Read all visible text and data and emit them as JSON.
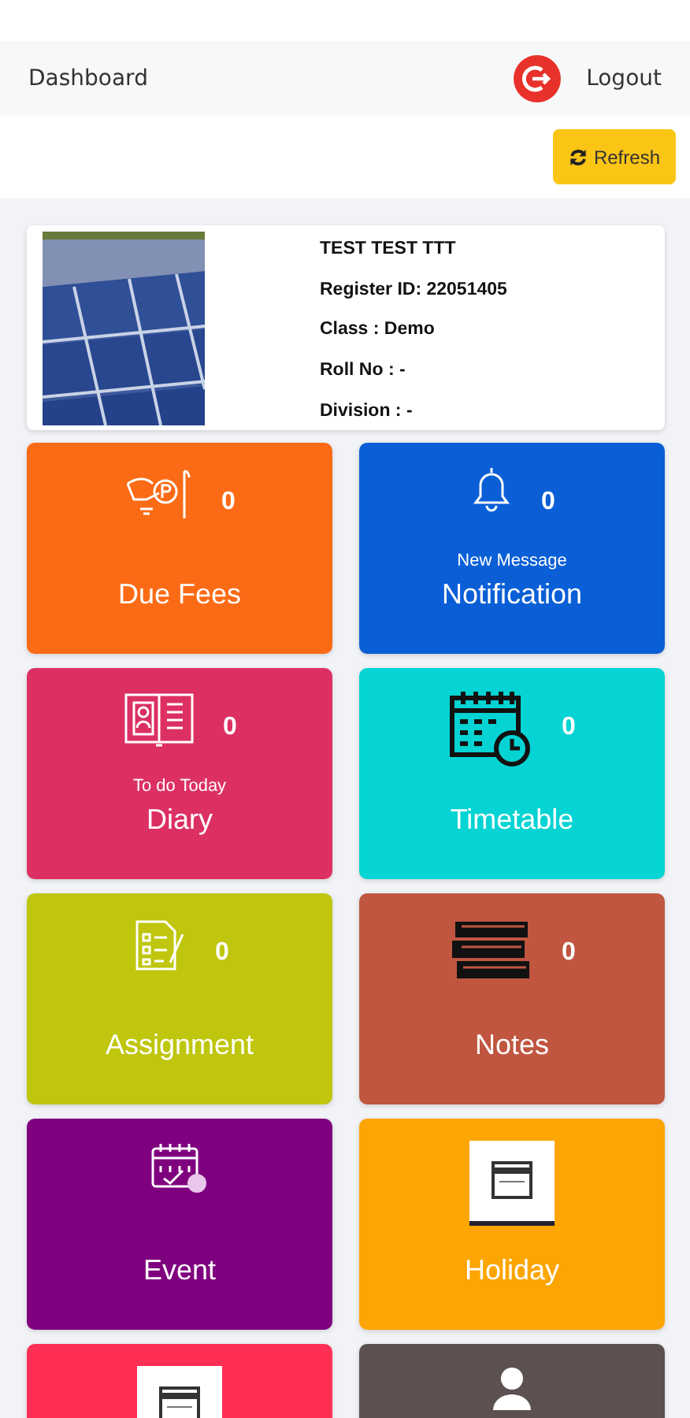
{
  "header": {
    "title": "Dashboard",
    "logout": "Logout"
  },
  "refresh": "Refresh",
  "profile": {
    "name": "TEST TEST TTT",
    "lines": [
      "Register ID: 22051405",
      "Class : Demo",
      "Roll No : -",
      "Division : -"
    ]
  },
  "tiles": [
    {
      "kind": "fees",
      "color": "#fb6b16",
      "count": "0",
      "title": "Due Fees"
    },
    {
      "kind": "bell",
      "color": "#0a5fd6",
      "count": "0",
      "subtitle": "New Message",
      "title": "Notification"
    },
    {
      "kind": "diary",
      "color": "#dc3063",
      "count": "0",
      "subtitle": "To do Today",
      "title": "Diary"
    },
    {
      "kind": "timetable",
      "color": "#06d3d3",
      "count": "0",
      "title": "Timetable"
    },
    {
      "kind": "assignment",
      "color": "#bfc60d",
      "count": "0",
      "title": "Assignment"
    },
    {
      "kind": "books",
      "color": "#c05640",
      "count": "0",
      "title": "Notes"
    },
    {
      "kind": "event",
      "color": "#7f007f",
      "title": "Event"
    },
    {
      "kind": "holiday",
      "color": "#fda502",
      "title": "Holiday"
    },
    {
      "kind": "holiday",
      "color": "#fe2e55"
    },
    {
      "kind": "profile",
      "color": "#5c5150"
    }
  ]
}
